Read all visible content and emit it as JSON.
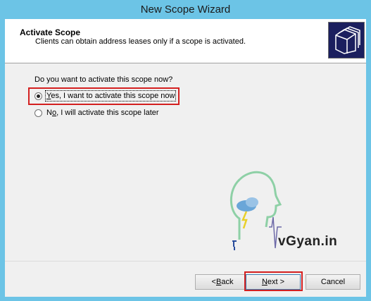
{
  "window": {
    "title": "New Scope Wizard"
  },
  "header": {
    "title": "Activate Scope",
    "subtitle": "Clients can obtain address leases only if a scope is activated.",
    "icon": "folders-icon"
  },
  "body": {
    "question": "Do you want to activate this scope now?",
    "options": [
      {
        "prefix": "",
        "accel": "Y",
        "rest": "es, I want to activate this scope now",
        "checked": true
      },
      {
        "prefix": "N",
        "accel": "o",
        "rest": ", I will activate this scope later",
        "checked": false
      }
    ]
  },
  "footer": {
    "back_prefix": "< ",
    "back_accel": "B",
    "back_rest": "ack",
    "next_accel": "N",
    "next_rest": "ext >",
    "cancel_label": "Cancel"
  },
  "watermark": {
    "text": "vGyan.in",
    "icon": "brain-head-logo"
  },
  "colors": {
    "highlight": "#d42020",
    "header_icon_bg": "#1b1f5e"
  }
}
